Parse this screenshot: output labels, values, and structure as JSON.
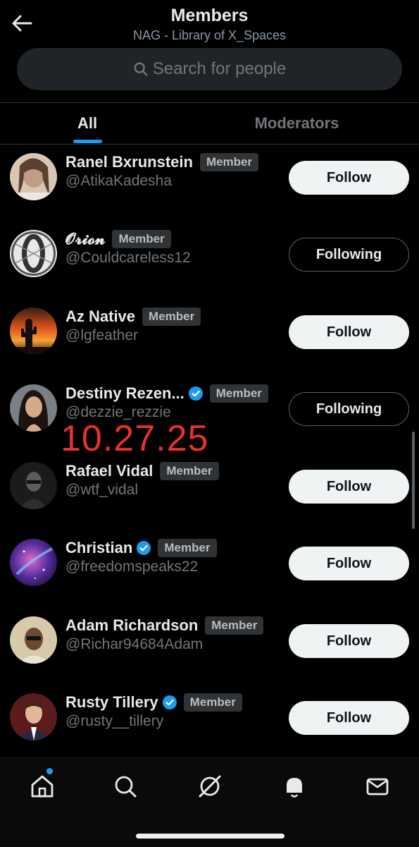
{
  "header": {
    "title": "Members",
    "subtitle": "NAG - Library of X_Spaces",
    "search_placeholder": "Search for people"
  },
  "tabs": [
    {
      "label": "All",
      "active": true
    },
    {
      "label": "Moderators",
      "active": false
    }
  ],
  "members": [
    {
      "name": "Ranel Bxrunstein",
      "handle": "@AtikaKadesha",
      "badge": "Member",
      "verified": false,
      "button": "Follow"
    },
    {
      "name": "𝓞𝓻𝓲𝓸𝓷",
      "handle": "@Couldcareless12",
      "badge": "Member",
      "verified": false,
      "button": "Following"
    },
    {
      "name": "Az Native",
      "handle": "@lgfeather",
      "badge": "Member",
      "verified": false,
      "button": "Follow"
    },
    {
      "name": "Destiny Rezen...",
      "handle": "@dezzie_rezzie",
      "badge": "Member",
      "verified": true,
      "button": "Following"
    },
    {
      "name": "Rafael Vidal",
      "handle": "@wtf_vidal",
      "badge": "Member",
      "verified": false,
      "button": "Follow"
    },
    {
      "name": "Christian",
      "handle": "@freedomspeaks22",
      "badge": "Member",
      "verified": true,
      "button": "Follow"
    },
    {
      "name": "Adam Richardson",
      "handle": "@Richar94684Adam",
      "badge": "Member",
      "verified": false,
      "button": "Follow"
    },
    {
      "name": "Rusty Tillery",
      "handle": "@rusty__tillery",
      "badge": "Member",
      "verified": true,
      "button": "Follow"
    }
  ],
  "overlay_date": "10.27.25",
  "colors": {
    "accent": "#1d9bf0",
    "background": "#000000",
    "overlay_text": "#e8312a"
  },
  "bottom_nav": [
    {
      "icon": "home-icon",
      "has_dot": true
    },
    {
      "icon": "search-icon"
    },
    {
      "icon": "grok-icon"
    },
    {
      "icon": "bell-icon"
    },
    {
      "icon": "mail-icon"
    }
  ]
}
